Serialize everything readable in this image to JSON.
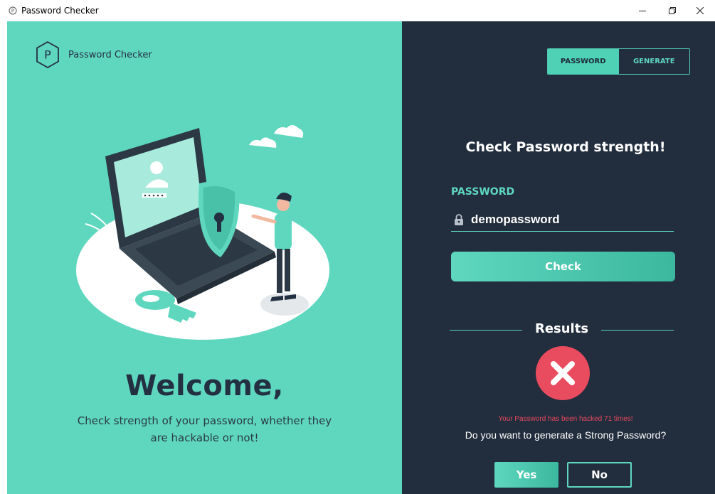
{
  "window": {
    "title": "Password Checker"
  },
  "brand": {
    "logo_letter": "P",
    "name": "Password Checker"
  },
  "tabs": [
    {
      "label": "PASSWORD",
      "active": true
    },
    {
      "label": "GENERATE",
      "active": false
    }
  ],
  "welcome": {
    "title": "Welcome,",
    "subtitle": "Check strength of your password, whether they are hackable or not!"
  },
  "check": {
    "heading": "Check Password strength!",
    "field_label": "PASSWORD",
    "password_value": "demopassword",
    "button_label": "Check"
  },
  "results": {
    "label": "Results",
    "status_icon": "x-circle-icon",
    "hacked_message": "Your Password has been hacked 71 times!",
    "question": "Do you want to generate a Strong Password?",
    "yes_label": "Yes",
    "no_label": "No"
  },
  "colors": {
    "teal": "#5fd7bf",
    "navy": "#222d3d",
    "danger": "#e94b5f"
  }
}
